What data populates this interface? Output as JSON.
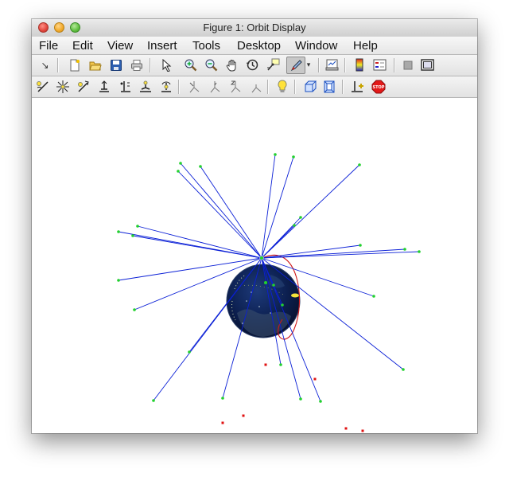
{
  "window": {
    "title": "Figure 1: Orbit Display"
  },
  "menu": [
    {
      "label": "File"
    },
    {
      "label": "Edit"
    },
    {
      "label": "View"
    },
    {
      "label": "Insert"
    },
    {
      "label": "Tools"
    },
    {
      "label": "Desktop"
    },
    {
      "label": "Window"
    },
    {
      "label": "Help"
    }
  ],
  "toolbar_main": [
    "dock-arrow-icon",
    "new-figure-icon",
    "open-file-icon",
    "save-icon",
    "print-icon",
    "edit-plot-pointer-icon",
    "zoom-in-icon",
    "zoom-out-icon",
    "pan-hand-icon",
    "rotate-3d-icon",
    "data-cursor-icon",
    "brush-icon",
    "brush-dropdown-icon",
    "link-plot-icon",
    "insert-colorbar-icon",
    "insert-legend-icon",
    "hide-plot-tools-icon",
    "show-plot-tools-icon"
  ],
  "toolbar_camera": [
    "orbit-camera-icon",
    "orbit-scene-light-icon",
    "pan-tilt-camera-icon",
    "move-camera-horizontal-icon",
    "move-camera-forward-back-icon",
    "zoom-camera-icon",
    "roll-camera-icon",
    "x-principal-axis-icon",
    "y-principal-axis-icon",
    "z-principal-axis-icon",
    "no-principal-axis-icon",
    "toggle-scene-light-icon",
    "orthographic-projection-icon",
    "perspective-projection-icon",
    "reset-camera-icon",
    "stop-camera-icon"
  ],
  "colors": {
    "link_lines": "#0a1fd6",
    "satellites": "#22d12e",
    "debris": "#e01010",
    "orbit_path": "#d01818",
    "globe": "#0b1c45"
  },
  "scene": {
    "hub_satellite": true,
    "blue_link_count": 26
  }
}
